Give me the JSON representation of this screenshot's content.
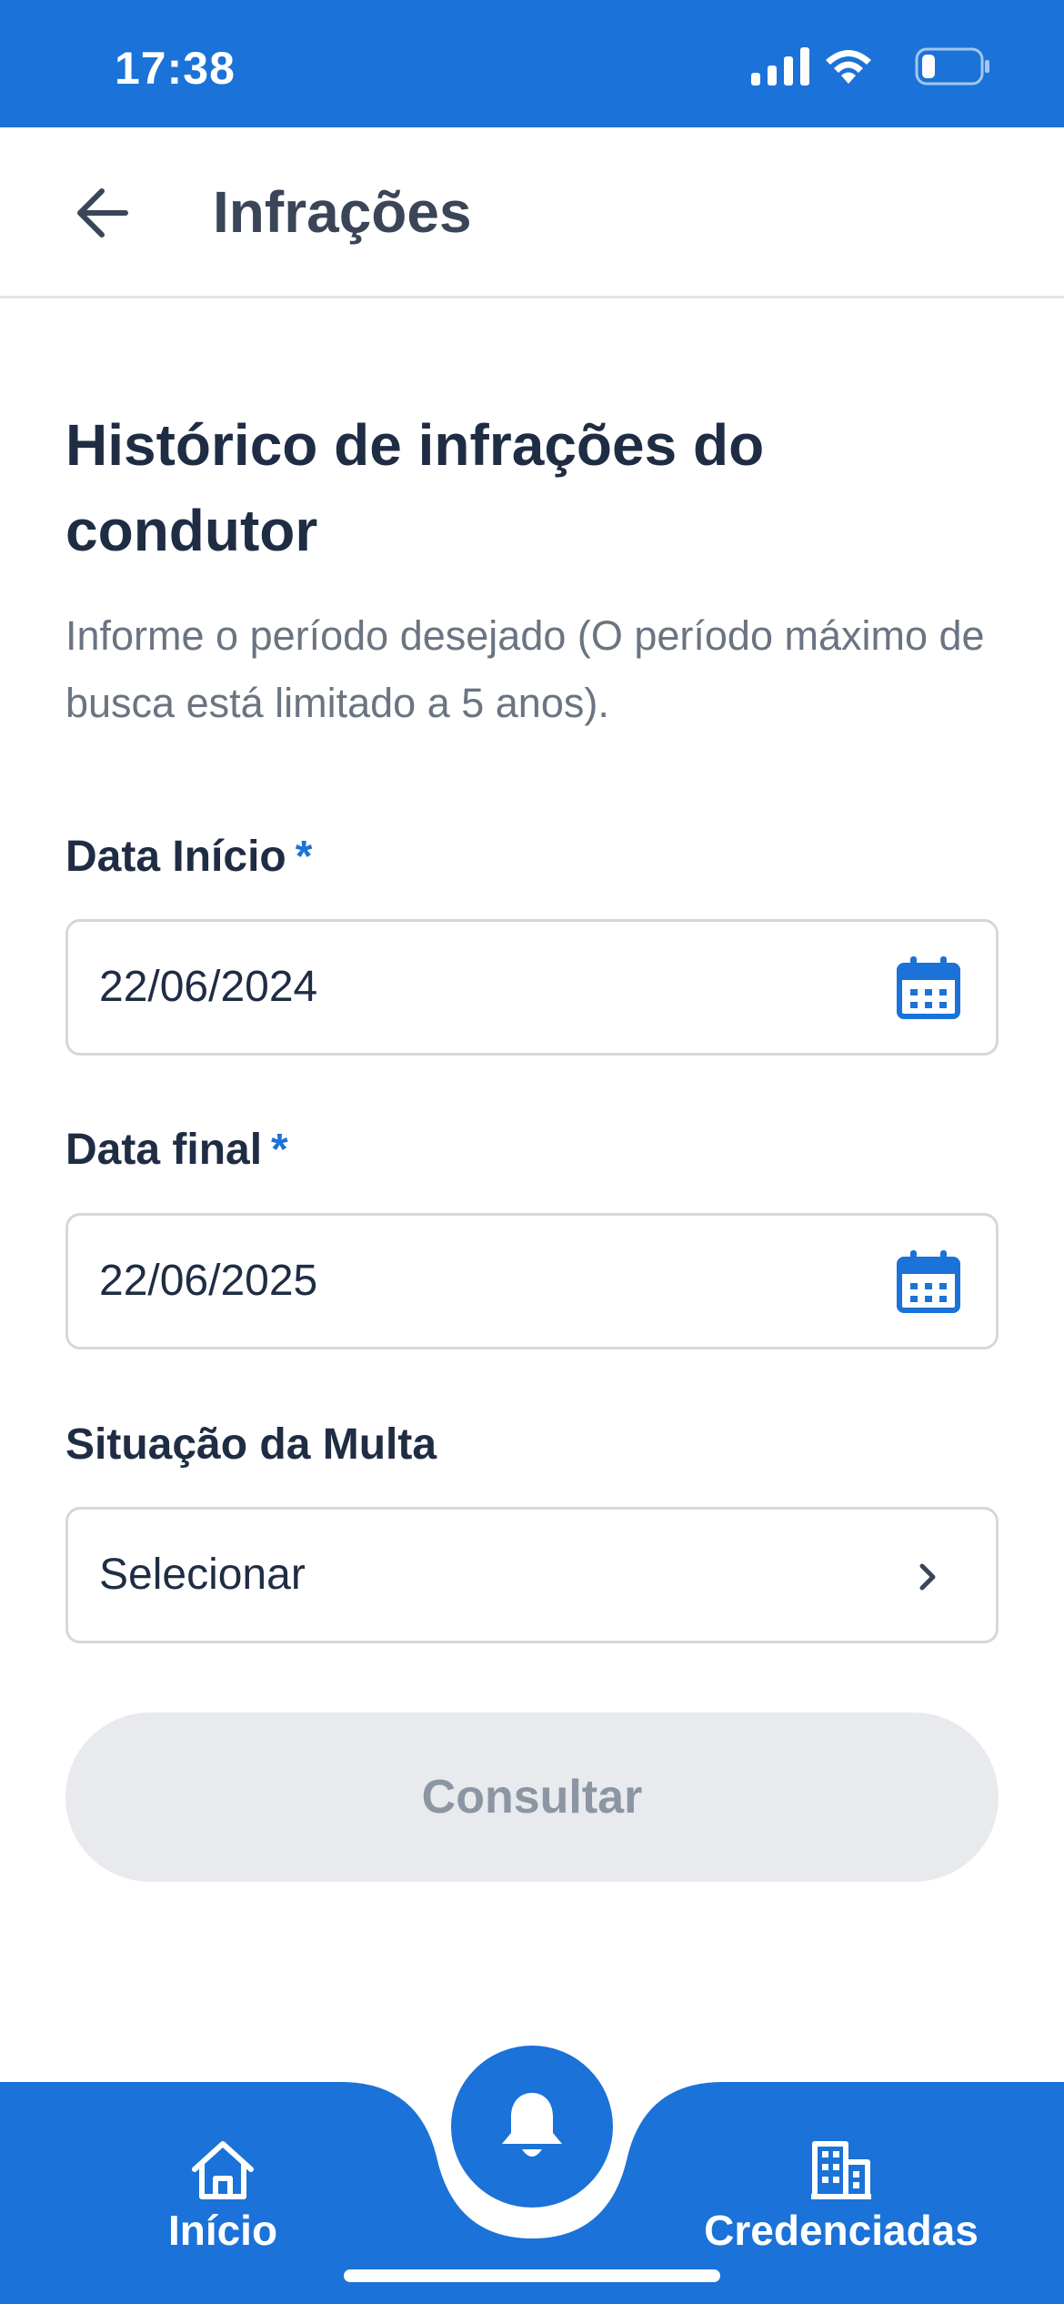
{
  "status_bar": {
    "time": "17:38"
  },
  "header": {
    "title": "Infrações"
  },
  "content": {
    "heading": "Histórico de infrações do condutor",
    "subtitle": "Informe o período desejado (O período máximo de busca está limitado a 5 anos)."
  },
  "form": {
    "start_date": {
      "label": "Data Início",
      "required_mark": "*",
      "value": "22/06/2024",
      "icon": "calendar-icon"
    },
    "end_date": {
      "label": "Data final",
      "required_mark": "*",
      "value": "22/06/2025",
      "icon": "calendar-icon"
    },
    "status": {
      "label": "Situação da Multa",
      "value": "Selecionar",
      "icon": "chevron-right-icon"
    },
    "submit_label": "Consultar"
  },
  "bottom_nav": {
    "items": [
      {
        "label": "Início",
        "icon": "home-icon"
      },
      {
        "label": "Credenciadas",
        "icon": "building-icon"
      }
    ],
    "fab_icon": "bell-icon"
  },
  "colors": {
    "primary": "#1b72d8",
    "text": "#1f2d44",
    "muted": "#6a7482",
    "disabled_bg": "#e8eaee"
  }
}
